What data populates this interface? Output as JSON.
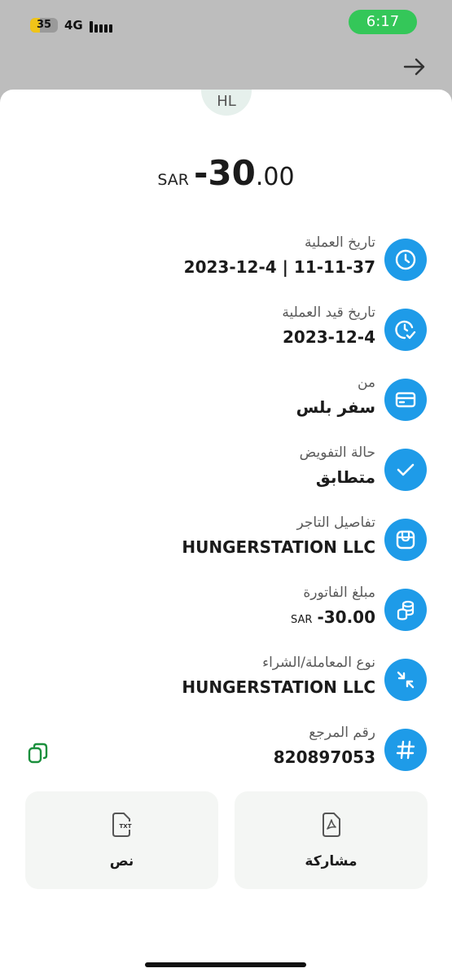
{
  "status_bar": {
    "battery": "35",
    "battery_level": 0.35,
    "network": "4G",
    "time": "6:17"
  },
  "header": {
    "back_icon": "arrow-right-icon"
  },
  "merchant_avatar": "HL",
  "amount": {
    "currency": "SAR",
    "integer": "-30",
    "decimal": ".00"
  },
  "details": [
    {
      "label": "تاريخ العملية",
      "value": "2023-12-4 | 11-11-37",
      "icon": "clock-icon"
    },
    {
      "label": "تاريخ قيد العملية",
      "value": "2023-12-4",
      "icon": "clock-check-icon"
    },
    {
      "label": "من",
      "value": "سفر بلس",
      "icon": "card-icon"
    },
    {
      "label": "حالة التفويض",
      "value": "متطابق",
      "icon": "check-icon"
    },
    {
      "label": "تفاصيل التاجر",
      "value": "HUNGERSTATION LLC",
      "icon": "store-icon"
    },
    {
      "label": "مبلغ الفاتورة",
      "value_currency": "SAR",
      "value": "-30.00",
      "icon": "coins-icon"
    },
    {
      "label": "نوع المعاملة/الشراء",
      "value": "HUNGERSTATION LLC",
      "icon": "arrows-in-icon"
    },
    {
      "label": "رقم المرجع",
      "value": "820897053",
      "icon": "hash-icon",
      "copy_icon": "copy-icon"
    }
  ],
  "actions": {
    "share": {
      "label": "مشاركة",
      "icon": "pdf-file-icon"
    },
    "text": {
      "label": "نص",
      "icon": "txt-file-icon",
      "badge": "TXT"
    }
  },
  "colors": {
    "accent": "#1e9be8",
    "time_pill": "#34c759",
    "copy_icon": "#1a8f3c"
  }
}
